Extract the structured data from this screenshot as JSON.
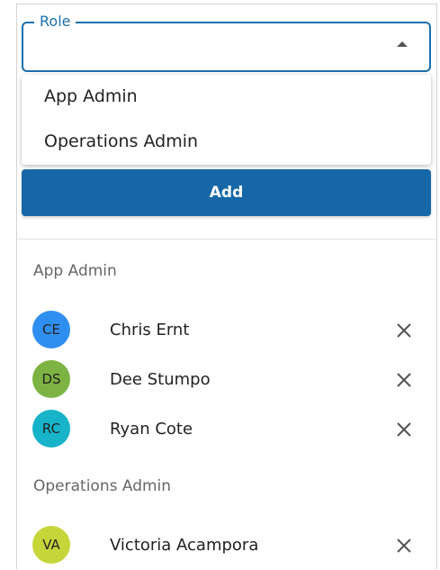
{
  "role_field": {
    "legend": "Role",
    "value": ""
  },
  "dropdown": {
    "options": [
      "App Admin",
      "Operations Admin"
    ]
  },
  "add_button": {
    "label": "Add",
    "color": "#1767a6"
  },
  "groups": [
    {
      "title": "App Admin",
      "members": [
        {
          "initials": "CE",
          "name": "Chris Ernt",
          "avatar_color": "#2f8ff0"
        },
        {
          "initials": "DS",
          "name": "Dee Stumpo",
          "avatar_color": "#7cb342"
        },
        {
          "initials": "RC",
          "name": "Ryan Cote",
          "avatar_color": "#17b3c9"
        }
      ]
    },
    {
      "title": "Operations Admin",
      "members": [
        {
          "initials": "VA",
          "name": "Victoria Acampora",
          "avatar_color": "#c6d63a"
        }
      ]
    }
  ],
  "icons": {
    "select_caret": "caret-up-icon",
    "remove": "close-icon"
  }
}
